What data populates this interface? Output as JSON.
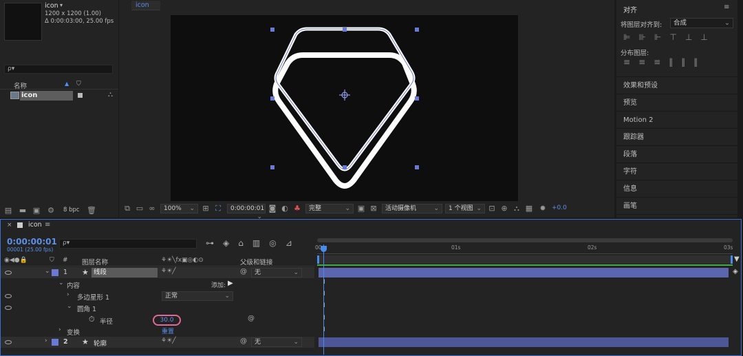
{
  "project": {
    "comp_name": "icon",
    "comp_size": "1200 x 1200 (1.00)",
    "comp_duration": "Δ 0:00:03:00, 25.00 fps",
    "search_placeholder": "ρ▾",
    "col_name": "名称",
    "item_name": "icon",
    "bpc": "8 bpc"
  },
  "viewer": {
    "tab": "icon",
    "zoom": "100%",
    "timecode": "0:00:00:01",
    "quality": "完整",
    "camera": "活动摄像机",
    "views": "1 个视图",
    "exposure": "+0.0"
  },
  "right": {
    "align_title": "对齐",
    "align_to_label": "将图层对齐到:",
    "align_to_value": "合成",
    "distribute_label": "分布图层:",
    "panels": [
      "效果和预设",
      "预览",
      "Motion 2",
      "跟踪器",
      "段落",
      "字符",
      "信息",
      "画笔"
    ]
  },
  "timeline": {
    "tab": "icon",
    "timecode": "0:00:00:01",
    "frame_info": "00001 (25.00 fps)",
    "col_layer_name": "图层名称",
    "col_parent": "父级和链接",
    "col_hash": "#",
    "ruler": [
      "00s",
      "01s",
      "02s",
      "03s"
    ],
    "layers": [
      {
        "num": "1",
        "name": "线段",
        "parent": "无"
      },
      {
        "num": "2",
        "name": "轮廓",
        "parent": "无"
      }
    ],
    "contents_label": "内容",
    "add_label": "添加:",
    "polystar_label": "多边星形 1",
    "blend_mode": "正常",
    "round_corners_label": "圆角 1",
    "radius_label": "半径",
    "radius_value": "30.0",
    "reset_label": "重置",
    "transform_label": "变换"
  }
}
